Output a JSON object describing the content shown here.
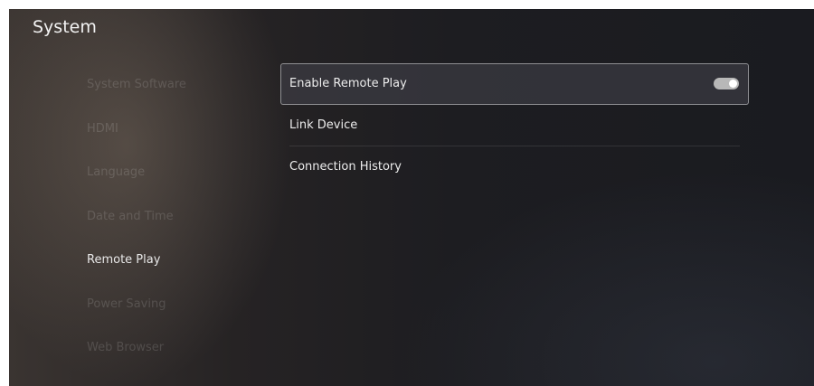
{
  "header": {
    "title": "System"
  },
  "sidebar": {
    "items": [
      {
        "label": "System Software"
      },
      {
        "label": "HDMI"
      },
      {
        "label": "Language"
      },
      {
        "label": "Date and Time"
      },
      {
        "label": "Remote Play"
      },
      {
        "label": "Power Saving"
      },
      {
        "label": "Web Browser"
      }
    ],
    "active_index": 4
  },
  "content": {
    "rows": [
      {
        "label": "Enable Remote Play",
        "toggle_on": true
      },
      {
        "label": "Link Device"
      },
      {
        "label": "Connection History"
      }
    ]
  },
  "colors": {
    "background": "#1d1d21",
    "text": "#ececec",
    "toggle_on": "#b8b8b8"
  }
}
